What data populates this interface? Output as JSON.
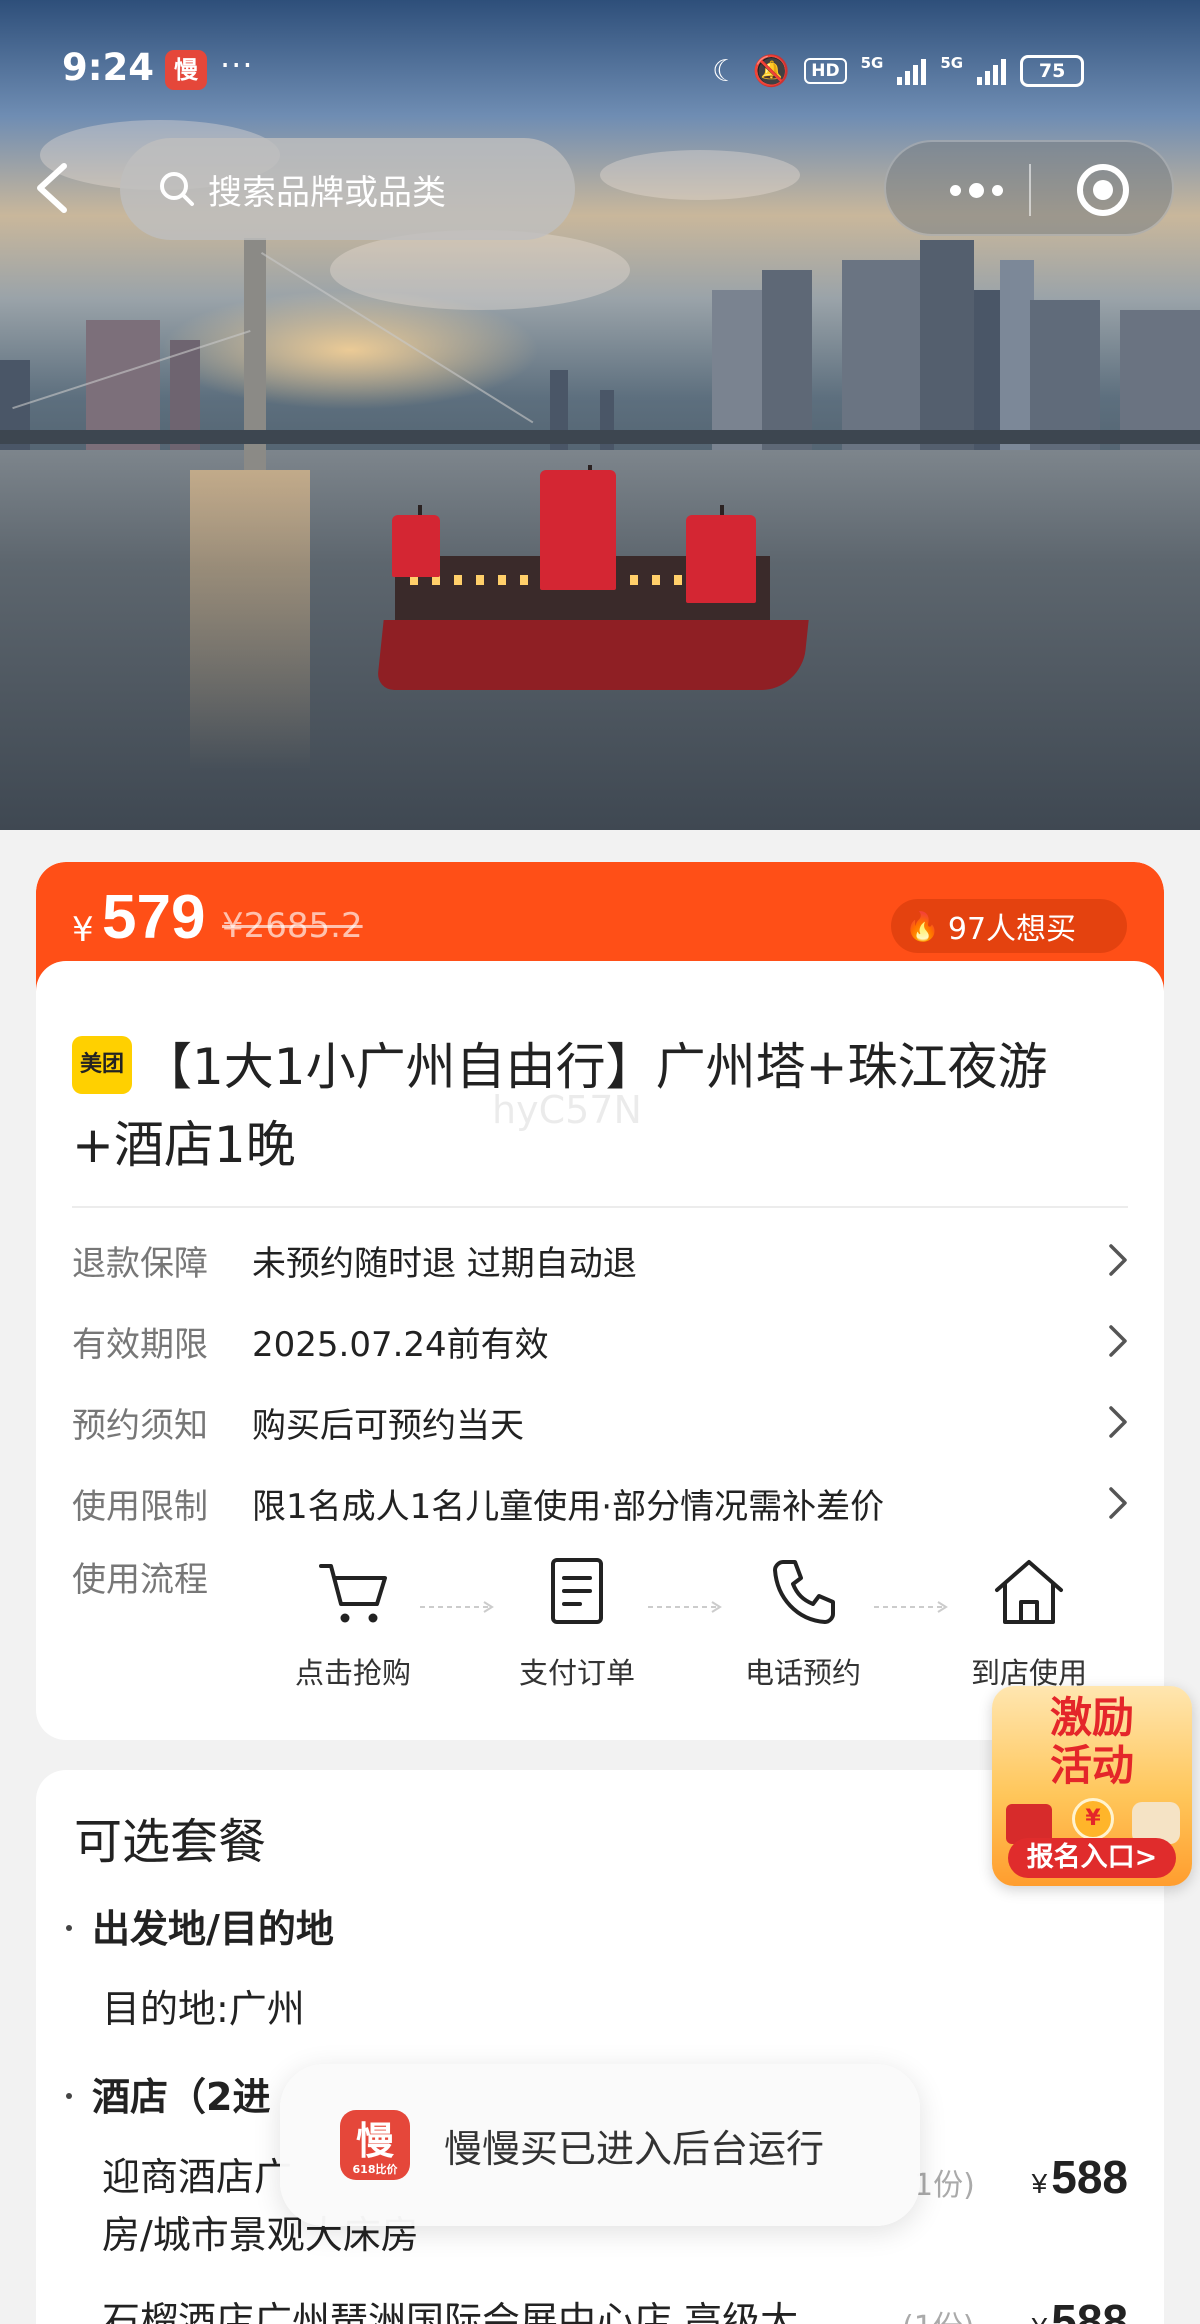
{
  "status_bar": {
    "time": "9:24",
    "app_badge": "慢",
    "more": "···",
    "network_5g_1": "5G",
    "network_5g_2": "5G",
    "hd_badge": "HD",
    "battery": "75"
  },
  "nav": {
    "search_placeholder": "搜索品牌或品类"
  },
  "price": {
    "currency": "¥",
    "current": "579",
    "original": "¥2685.2",
    "want_count_text": "97人想买"
  },
  "product": {
    "brand_badge": "美团",
    "title": "【1大1小广州自由行】广州塔+珠江夜游+酒店1晚",
    "watermark": "hyC57N"
  },
  "info_rows": [
    {
      "label": "退款保障",
      "value": "未预约随时退 过期自动退"
    },
    {
      "label": "有效期限",
      "value": "2025.07.24前有效"
    },
    {
      "label": "预约须知",
      "value": "购买后可预约当天"
    },
    {
      "label": "使用限制",
      "value": "限1名成人1名儿童使用·部分情况需补差价"
    }
  ],
  "usage_flow": {
    "label": "使用流程",
    "steps": [
      {
        "icon": "cart-icon",
        "label": "点击抢购"
      },
      {
        "icon": "order-icon",
        "label": "支付订单"
      },
      {
        "icon": "phone-icon",
        "label": "电话预约"
      },
      {
        "icon": "home-icon",
        "label": "到店使用"
      }
    ]
  },
  "promo": {
    "title_line1": "激励",
    "title_line2": "活动",
    "coin": "¥",
    "button": "报名入口>"
  },
  "packages": {
    "title": "可选套餐",
    "groups": [
      {
        "heading": "出发地/目的地",
        "text": "目的地:广州"
      },
      {
        "heading": "酒店（2进"
      }
    ],
    "items": [
      {
        "line1": "迎商酒店广",
        "line2": "房/城市景观大床房",
        "qty": "1份)",
        "price": "588"
      },
      {
        "line1": "石榴酒店广州琶洲国际会展中心店 高级大",
        "qty": "(1份)",
        "price": "588"
      }
    ],
    "currency": "¥"
  },
  "toast": {
    "icon_text": "慢",
    "icon_sub": "618比价",
    "text": "慢慢买已进入后台运行"
  },
  "colors": {
    "accent_orange": "#ff4f17",
    "brand_yellow": "#ffd000",
    "promo_red": "#e4262a"
  }
}
